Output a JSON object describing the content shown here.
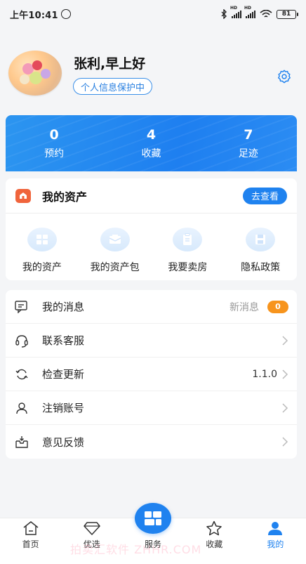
{
  "status_bar": {
    "time": "上午10:41",
    "battery": "81",
    "signal_label": "HD"
  },
  "profile": {
    "greeting": "张利,早上好",
    "privacy_badge": "个人信息保护中",
    "settings_icon": "gear-icon"
  },
  "stats": [
    {
      "value": "0",
      "label": "预约"
    },
    {
      "value": "4",
      "label": "收藏"
    },
    {
      "value": "7",
      "label": "足迹"
    }
  ],
  "assets": {
    "title": "我的资产",
    "view_button": "去查看",
    "items": [
      {
        "label": "我的资产",
        "icon": "grid-icon"
      },
      {
        "label": "我的资产包",
        "icon": "package-icon"
      },
      {
        "label": "我要卖房",
        "icon": "document-icon"
      },
      {
        "label": "隐私政策",
        "icon": "save-icon"
      }
    ]
  },
  "menu": [
    {
      "label": "我的消息",
      "icon": "message-icon",
      "right_text": "新消息",
      "badge": "0"
    },
    {
      "label": "联系客服",
      "icon": "headset-icon"
    },
    {
      "label": "检查更新",
      "icon": "refresh-icon",
      "right_text": "1.1.0"
    },
    {
      "label": "注销账号",
      "icon": "user-icon"
    },
    {
      "label": "意见反馈",
      "icon": "feedback-icon"
    }
  ],
  "tabbar": {
    "active": "我的",
    "accent": "#1f82ef",
    "tabs": [
      {
        "label": "首页",
        "icon": "home-icon"
      },
      {
        "label": "优选",
        "icon": "diamond-icon"
      },
      {
        "label": "服务",
        "icon": "service-icon"
      },
      {
        "label": "收藏",
        "icon": "star-icon"
      },
      {
        "label": "我的",
        "icon": "profile-icon"
      }
    ]
  },
  "watermark": "拍卖汇软件 ZHHR.COM"
}
